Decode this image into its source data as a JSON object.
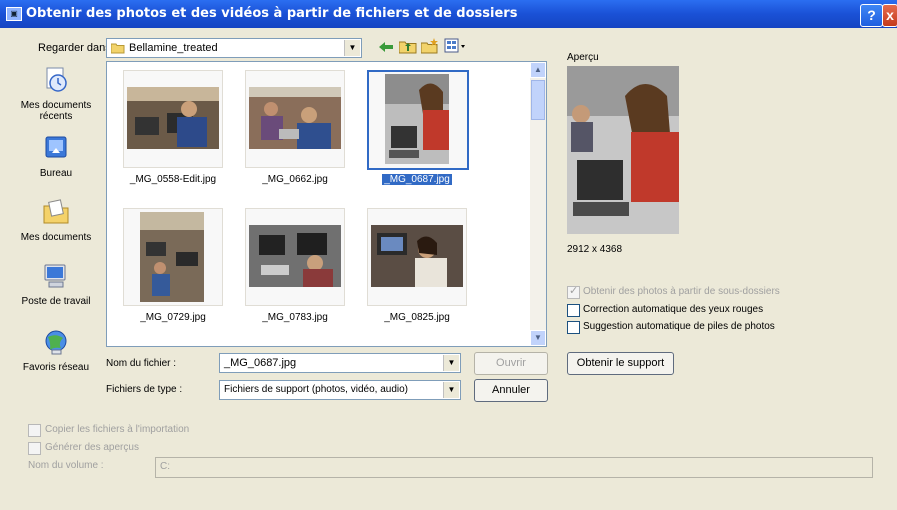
{
  "window": {
    "title": "Obtenir des photos et des vidéos à partir de fichiers et de dossiers",
    "help_label": "?",
    "close_label": "x"
  },
  "lookin": {
    "label": "Regarder dans :",
    "value": "Bellamine_treated"
  },
  "toolbar_icons": [
    "back-arrow-icon",
    "up-folder-icon",
    "new-folder-icon",
    "view-menu-icon"
  ],
  "places": [
    {
      "label": "Mes documents récents",
      "icon": "recent-documents-icon"
    },
    {
      "label": "Bureau",
      "icon": "desktop-icon"
    },
    {
      "label": "Mes documents",
      "icon": "my-documents-icon"
    },
    {
      "label": "Poste de travail",
      "icon": "my-computer-icon"
    },
    {
      "label": "Favoris réseau",
      "icon": "network-places-icon"
    }
  ],
  "files": [
    {
      "name": "_MG_0558-Edit.jpg",
      "selected": false
    },
    {
      "name": "_MG_0662.jpg",
      "selected": false
    },
    {
      "name": "_MG_0687.jpg",
      "selected": true
    },
    {
      "name": "_MG_0729.jpg",
      "selected": false
    },
    {
      "name": "_MG_0783.jpg",
      "selected": false
    },
    {
      "name": "_MG_0825.jpg",
      "selected": false
    }
  ],
  "preview": {
    "label": "Aperçu",
    "dimensions": "2912 x 4368"
  },
  "options": [
    {
      "label": "Obtenir des photos à partir de sous-dossiers",
      "checked": true,
      "enabled": false
    },
    {
      "label": "Correction automatique des yeux rouges",
      "checked": false,
      "enabled": true
    },
    {
      "label": "Suggestion automatique de piles de photos",
      "checked": false,
      "enabled": true
    }
  ],
  "filename": {
    "label": "Nom du fichier :",
    "value": "_MG_0687.jpg"
  },
  "filetype": {
    "label": "Fichiers de type :",
    "value": "Fichiers de support (photos, vidéo, audio)"
  },
  "buttons": {
    "open": "Ouvrir",
    "cancel": "Annuler",
    "get_media": "Obtenir le support"
  },
  "import_options": [
    {
      "label": "Copier les fichiers à l'importation",
      "enabled": false
    },
    {
      "label": "Générer des aperçus",
      "enabled": false
    }
  ],
  "volume": {
    "label": "Nom du volume :",
    "value": "C:"
  }
}
